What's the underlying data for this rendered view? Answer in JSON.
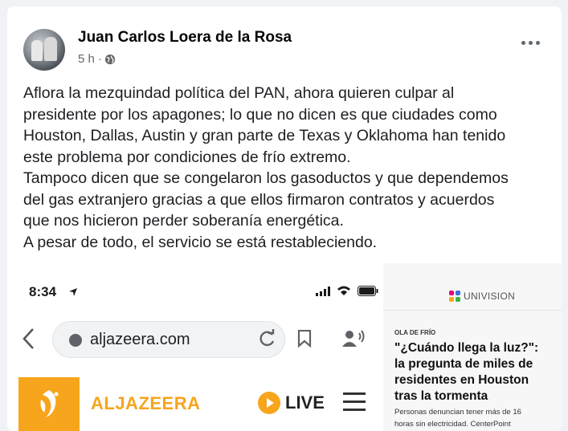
{
  "post": {
    "author": "Juan Carlos Loera de la Rosa",
    "time": "5 h ·",
    "audience_icon": "globe-icon",
    "more_icon": "more-options-icon",
    "text_lines": [
      "Aflora la mezquindad política del PAN, ahora quieren culpar al",
      "presidente por los apagones; lo que no dicen es que ciudades como",
      "Houston, Dallas, Austin y gran parte de Texas y Oklahoma han tenido",
      "este problema por condiciones de frío extremo.",
      "Tampoco dicen que se congelaron los gasoductos y que dependemos",
      "del gas extranjero gracias a que ellos firmaron contratos y acuerdos",
      "que nos hicieron perder soberanía energética.",
      "A pesar de todo, el servicio se está restableciendo."
    ]
  },
  "phone": {
    "time": "8:34",
    "url": "aljazeera.com",
    "brand": "ALJAZEERA",
    "live_label": "LIVE",
    "brand_color": "#f7a51c"
  },
  "univision": {
    "logo_text": "UNIVISION",
    "kicker": "OLA DE FRÍO",
    "headline_lines": [
      "\"¿Cuándo llega la luz?\":",
      "la pregunta de miles de",
      "residentes en Houston",
      "tras la tormenta"
    ],
    "sub_lines": [
      "Personas denuncian tener más de 16",
      "horas sin electricidad. CenterPoint"
    ]
  }
}
